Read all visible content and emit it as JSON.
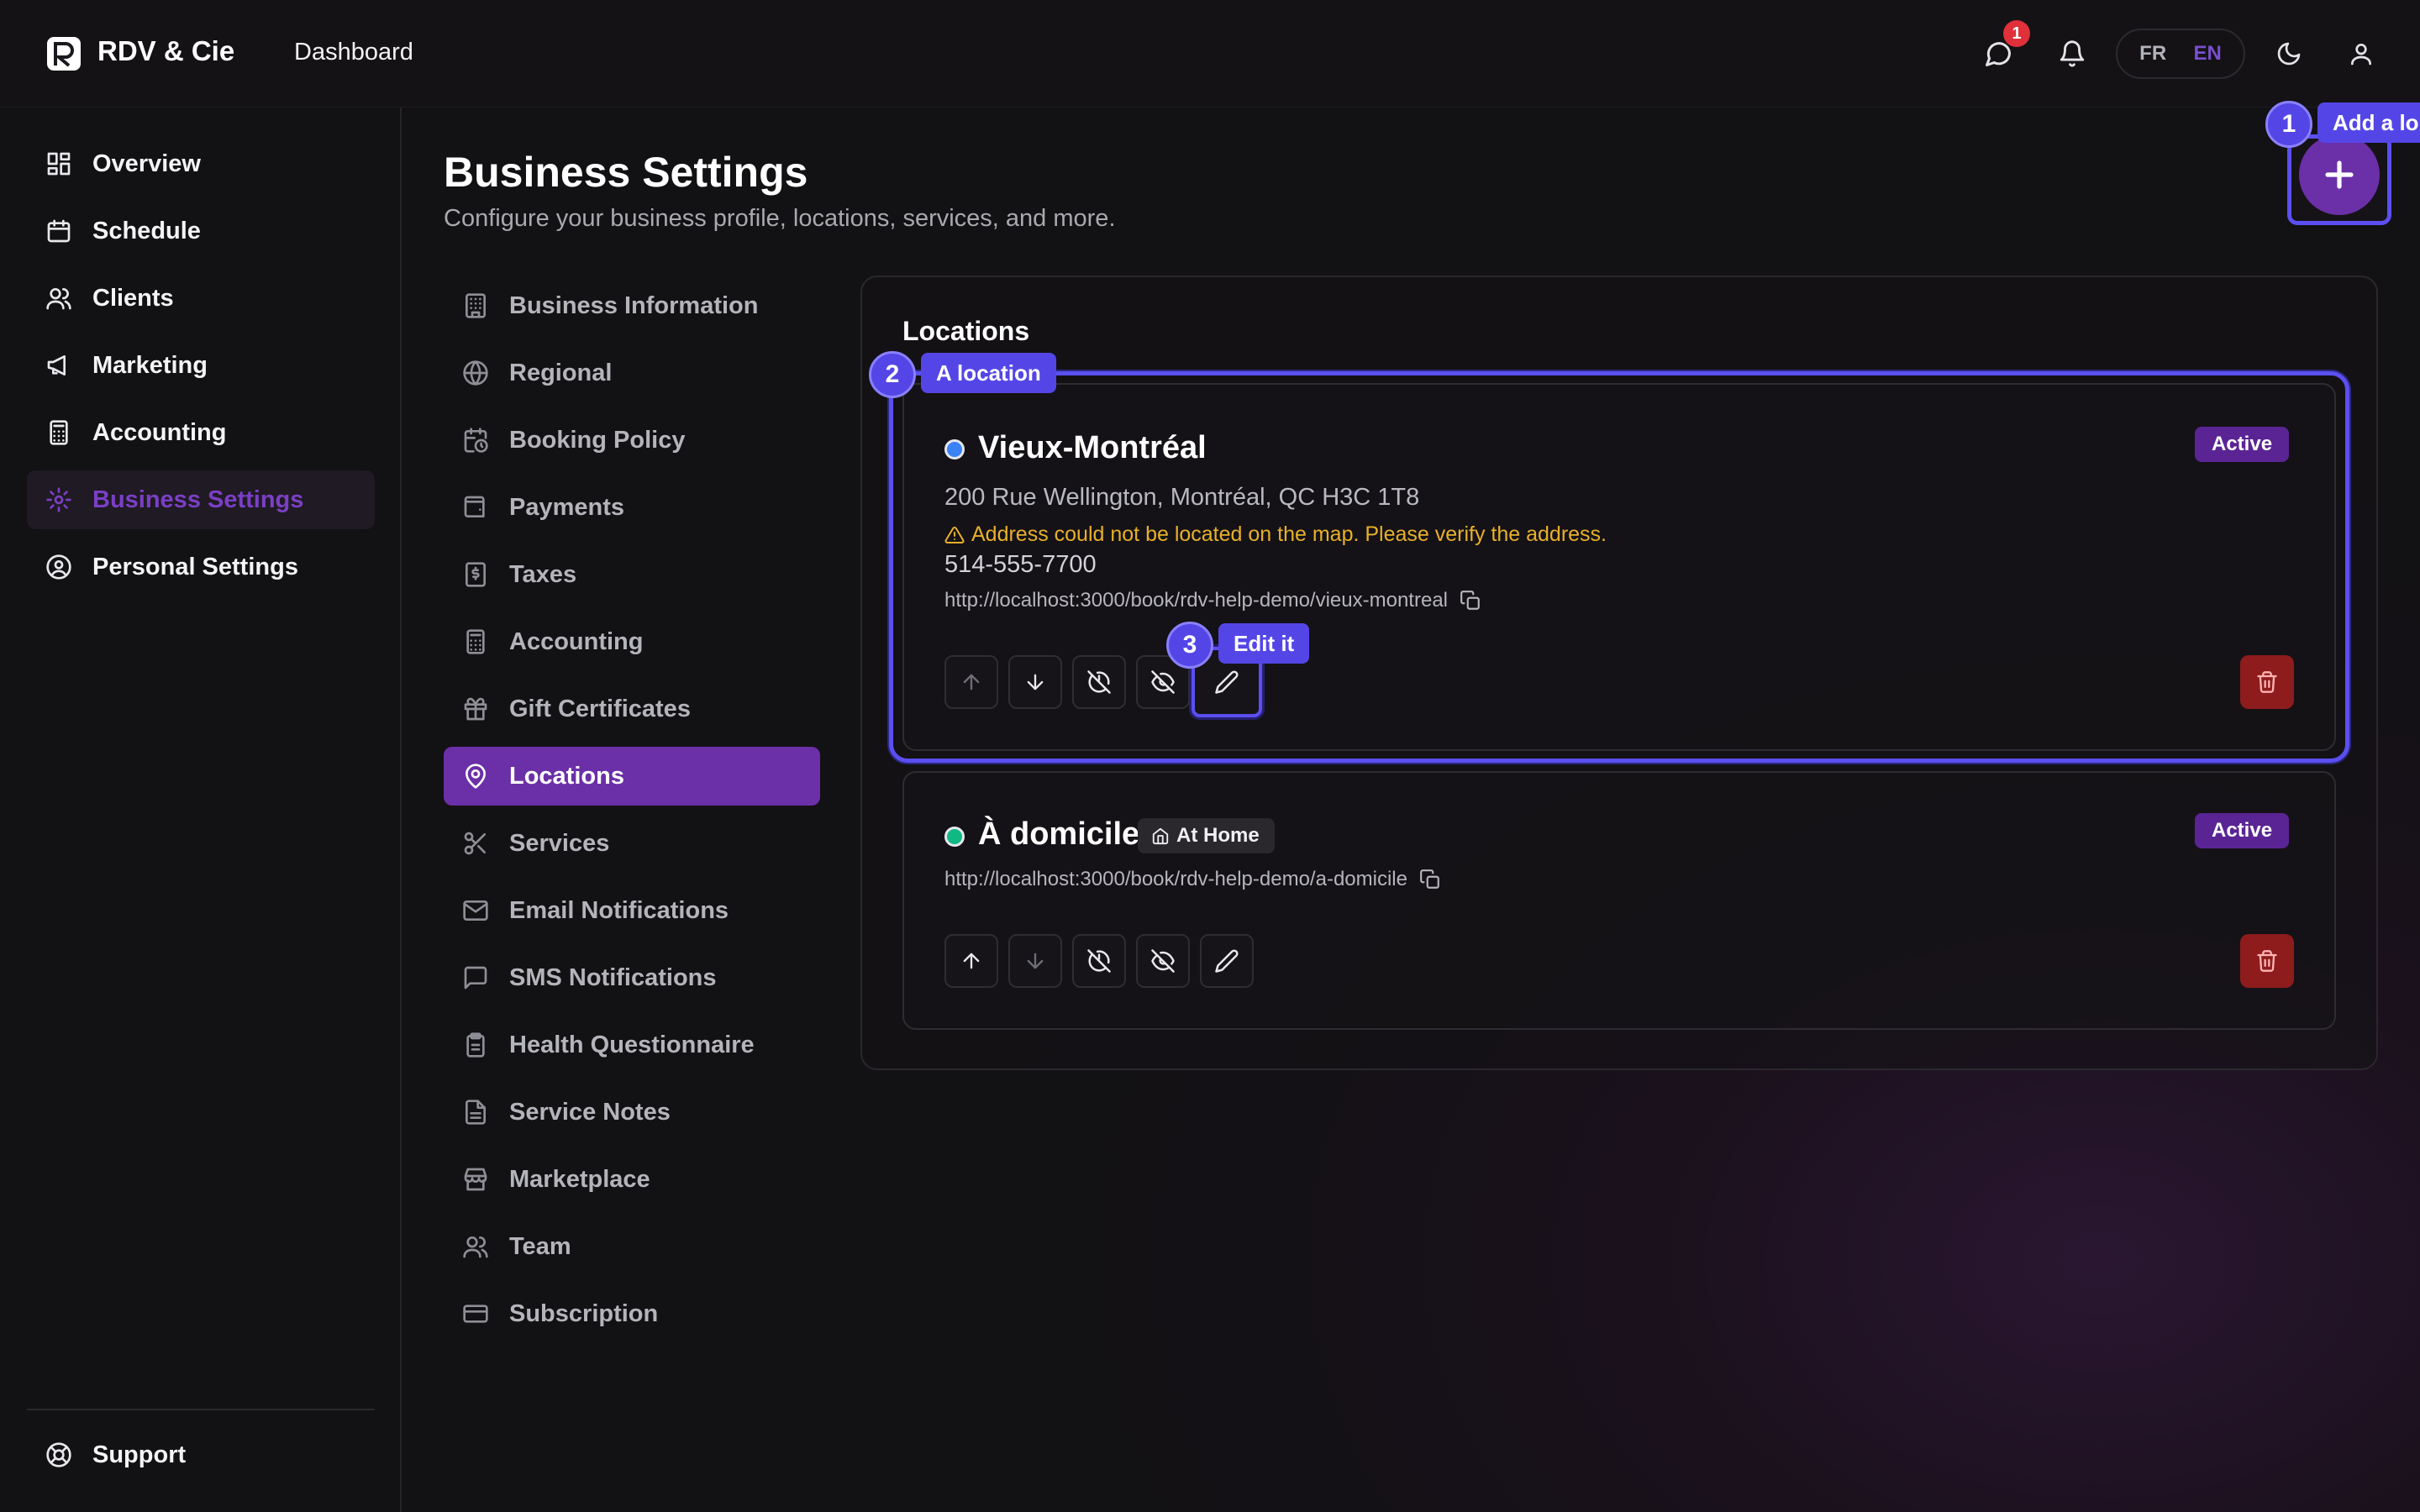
{
  "app": {
    "brand": "RDV & Cie",
    "breadcrumb": "Dashboard"
  },
  "topbar": {
    "messages_badge": "1",
    "lang_fr": "FR",
    "lang_en": "EN"
  },
  "sidebar": {
    "items": [
      {
        "label": "Overview",
        "icon": "grid-icon"
      },
      {
        "label": "Schedule",
        "icon": "calendar-icon"
      },
      {
        "label": "Clients",
        "icon": "users-icon"
      },
      {
        "label": "Marketing",
        "icon": "megaphone-icon"
      },
      {
        "label": "Accounting",
        "icon": "calculator-icon"
      },
      {
        "label": "Business Settings",
        "icon": "gear-icon",
        "active": true
      },
      {
        "label": "Personal Settings",
        "icon": "user-circle-icon"
      }
    ],
    "support": "Support"
  },
  "page": {
    "title": "Business Settings",
    "subtitle": "Configure your business profile, locations, services, and more."
  },
  "settings_nav": [
    "Business Information",
    "Regional",
    "Booking Policy",
    "Payments",
    "Taxes",
    "Accounting",
    "Gift Certificates",
    "Locations",
    "Services",
    "Email Notifications",
    "SMS Notifications",
    "Health Questionnaire",
    "Service Notes",
    "Marketplace",
    "Team",
    "Subscription"
  ],
  "settings_nav_active": "Locations",
  "locations": {
    "title": "Locations",
    "items": [
      {
        "name": "Vieux-Montréal",
        "status": "Active",
        "dot_color": "#3b82f6",
        "address": "200 Rue Wellington, Montréal, QC H3C 1T8",
        "warning": "Address could not be located on the map. Please verify the address.",
        "phone": "514-555-7700",
        "url": "http://localhost:3000/book/rdv-help-demo/vieux-montreal"
      },
      {
        "name": "À domicile",
        "status": "Active",
        "dot_color": "#10b981",
        "tag": "At Home",
        "url": "http://localhost:3000/book/rdv-help-demo/a-domicile"
      }
    ]
  },
  "tour": {
    "step1": {
      "num": "1",
      "label": "Add a lo"
    },
    "step2": {
      "num": "2",
      "label": "A location"
    },
    "step3": {
      "num": "3",
      "label": "Edit it"
    }
  },
  "colors": {
    "accent": "#6b2fa8",
    "tour": "#5446e6",
    "warning": "#e8b02a",
    "danger": "#8e1c1c"
  }
}
